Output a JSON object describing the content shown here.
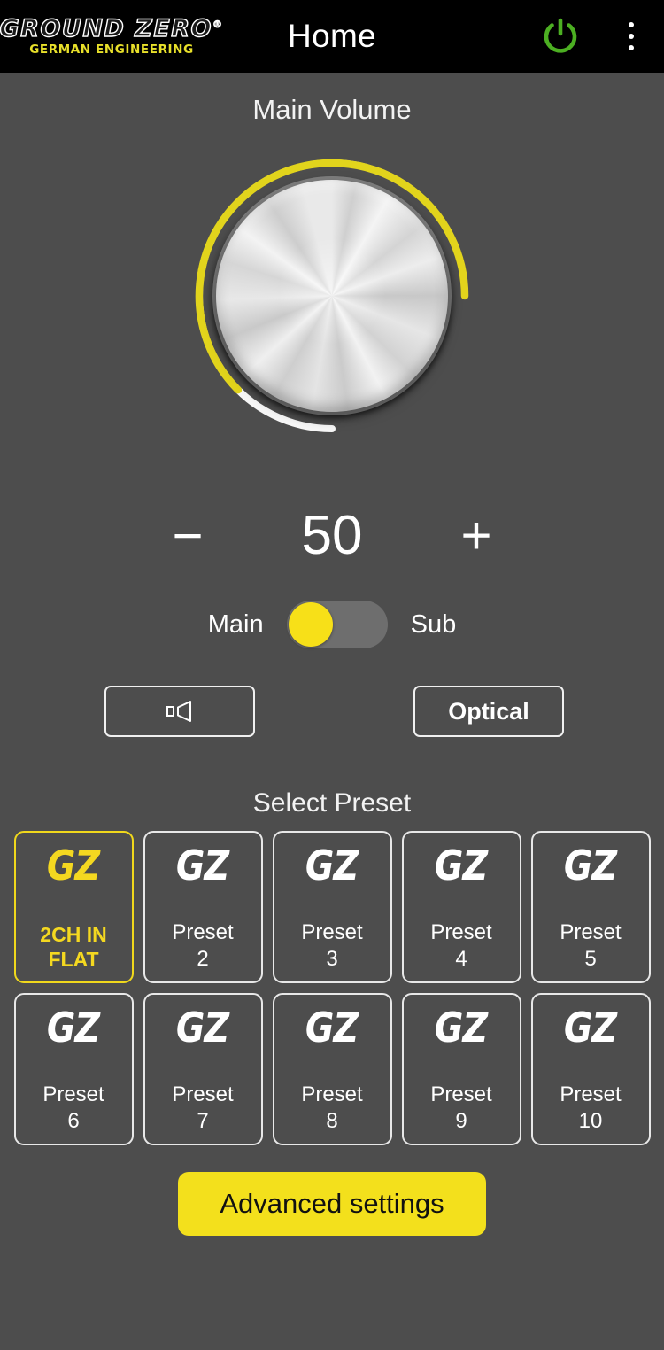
{
  "header": {
    "logo_main": "GROUND ZERO",
    "logo_reg": "®",
    "logo_sub": "GERMAN ENGINEERING",
    "title": "Home",
    "power_icon": "power-icon",
    "menu_icon": "overflow-menu-icon",
    "power_color": "#4caf22",
    "background": "#000000"
  },
  "volume": {
    "section_title": "Main Volume",
    "value": "50",
    "decrease_label": "−",
    "increase_label": "+",
    "knob_arc_color": "#e2d41c",
    "knob_track_color": "#f7f7f7",
    "knob_percent": 50
  },
  "channel_toggle": {
    "left_label": "Main",
    "right_label": "Sub",
    "selected": "Main",
    "knob_color": "#f7e018",
    "track_color": "#6e6e6e"
  },
  "sources": {
    "speaker_button_icon": "speaker-icon",
    "optical_label": "Optical"
  },
  "presets": {
    "title": "Select Preset",
    "logo_text": "GZ",
    "items": [
      {
        "label": "2CH IN\nFLAT",
        "label_line1": "2CH IN",
        "label_line2": "FLAT",
        "selected": true
      },
      {
        "label": "Preset 2",
        "label_line1": "Preset",
        "label_line2": "2",
        "selected": false
      },
      {
        "label": "Preset 3",
        "label_line1": "Preset",
        "label_line2": "3",
        "selected": false
      },
      {
        "label": "Preset 4",
        "label_line1": "Preset",
        "label_line2": "4",
        "selected": false
      },
      {
        "label": "Preset 5",
        "label_line1": "Preset",
        "label_line2": "5",
        "selected": false
      },
      {
        "label": "Preset 6",
        "label_line1": "Preset",
        "label_line2": "6",
        "selected": false
      },
      {
        "label": "Preset 7",
        "label_line1": "Preset",
        "label_line2": "7",
        "selected": false
      },
      {
        "label": "Preset 8",
        "label_line1": "Preset",
        "label_line2": "8",
        "selected": false
      },
      {
        "label": "Preset 9",
        "label_line1": "Preset",
        "label_line2": "9",
        "selected": false
      },
      {
        "label": "Preset 10",
        "label_line1": "Preset",
        "label_line2": "10",
        "selected": false
      }
    ],
    "selected_color": "#f4d820"
  },
  "footer": {
    "advanced_label": "Advanced settings",
    "advanced_bg": "#f3e01c"
  },
  "theme": {
    "page_background": "#4d4d4d",
    "accent_yellow": "#f3e01c",
    "text_white": "#ffffff"
  }
}
